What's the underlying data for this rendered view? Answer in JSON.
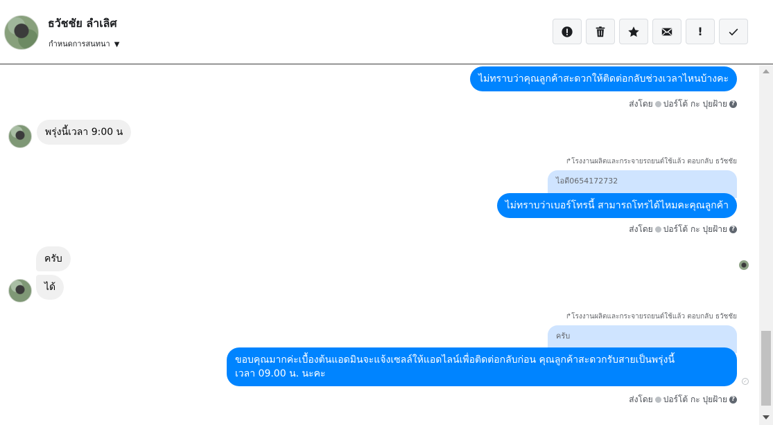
{
  "header": {
    "contact_name": "ธวัชชัย ลำเลิศ",
    "conversation_setting": "กำหนดการสนทนา",
    "toolbar": [
      {
        "name": "report-spam-button",
        "icon": "alert-circle-icon"
      },
      {
        "name": "delete-button",
        "icon": "trash-icon"
      },
      {
        "name": "star-button",
        "icon": "star-icon"
      },
      {
        "name": "mark-unread-button",
        "icon": "envelope-icon"
      },
      {
        "name": "mark-important-button",
        "icon": "exclamation-icon",
        "text": "!"
      },
      {
        "name": "mark-done-button",
        "icon": "checkmark-icon"
      }
    ]
  },
  "messages": {
    "m1": {
      "text": "ไม่ทราบว่าคุณลูกค้าสะดวกให้ติดต่อกลับช่วงเวลาไหนบ้างคะ"
    },
    "m1_sent_by": {
      "prefix": "ส่งโดย",
      "name": "ปอร์โต้ กะ ปุยฝ้าย"
    },
    "m2": {
      "text": "พรุ่งนี้เวลา 9:00 น"
    },
    "m3_reply_note": "โรงงานผลิตและกระจายรถยนต์ใช้แล้ว ตอบกลับ ธวัชชัย",
    "m3_quoted": "ไอดี0654172732",
    "m3": {
      "text": "ไม่ทราบว่าเบอร์โทรนี้ สามารถโทรได้ไหมคะคุณลูกค้า"
    },
    "m3_sent_by": {
      "prefix": "ส่งโดย",
      "name": "ปอร์โต้ กะ ปุยฝ้าย"
    },
    "m4": {
      "text": "ครับ"
    },
    "m5": {
      "text": "ได้"
    },
    "m6_reply_note": "โรงงานผลิตและกระจายรถยนต์ใช้แล้ว ตอบกลับ ธวัชชัย",
    "m6_quoted": "ครับ",
    "m6": {
      "line1": "ขอบคุณมากค่ะเบื้องต้นแอดมินจะแจ้งเซลล์ให้แอดไลน์เพื่อติดต่อกลับก่อน คุณลูกค้าสะดวกรับสายเป็นพรุ่งนี้",
      "line2": "เวลา 09.00 น. นะคะ"
    },
    "m6_sent_by": {
      "prefix": "ส่งโดย",
      "name": "ปอร์โต้ กะ ปุยฝ้าย"
    }
  },
  "colors": {
    "outgoing": "#0084ff",
    "incoming": "#f0f0f0",
    "quoted": "#cfe4ff"
  }
}
